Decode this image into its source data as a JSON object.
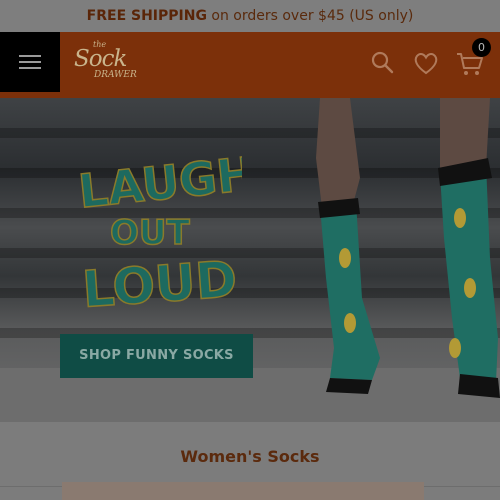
{
  "promo": {
    "bold": "FREE SHIPPING",
    "rest": " on orders over $45 (US only)"
  },
  "header": {
    "logo": {
      "the": "the",
      "sock": "Sock",
      "drawer": "DRAWER"
    },
    "cart_count": "0",
    "icons": [
      "menu-icon",
      "search-icon",
      "heart-icon",
      "cart-icon"
    ],
    "colors": {
      "bar": "#7c300a",
      "logo": "#c9b48c"
    }
  },
  "hero": {
    "headline": [
      "LAUGH",
      "OUT",
      "LOUD"
    ],
    "cta_label": "SHOP FUNNY SOCKS",
    "colors": {
      "headline": "#1d6a5f",
      "sock": "#2a8a7a",
      "cta": "#0f4c45"
    }
  },
  "section": {
    "title": "Women's Socks"
  }
}
